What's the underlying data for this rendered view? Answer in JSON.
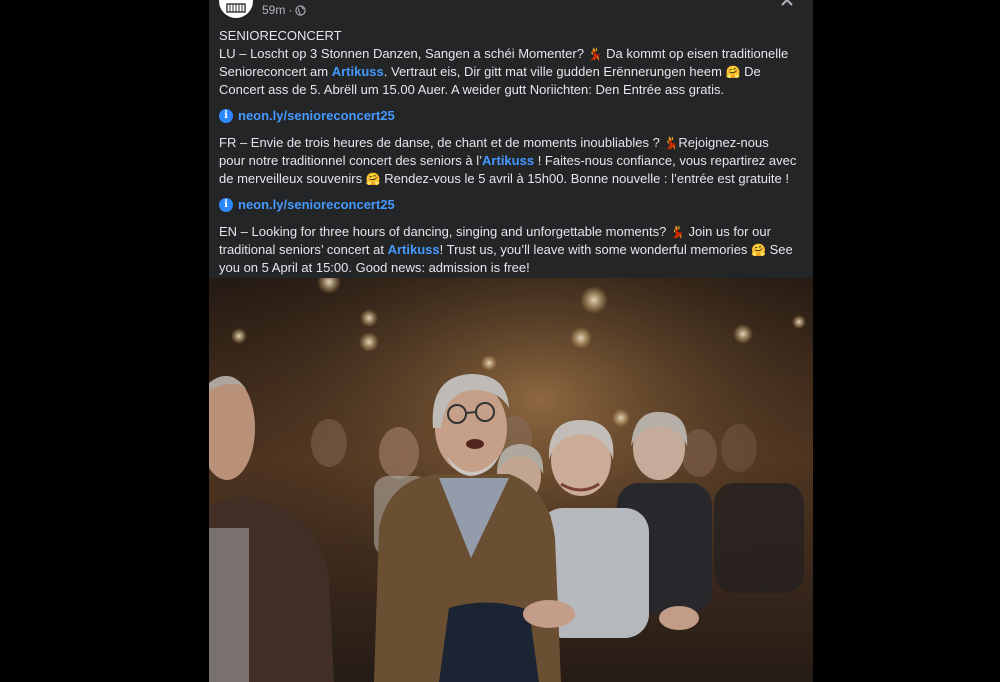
{
  "post": {
    "time": "59m",
    "separator": "·",
    "more_label": "···",
    "title": "SENIORECONCERT",
    "lu": {
      "l1a": "LU – Loscht op 3 Stonnen Danzen, Sangen a schéi Momenter? ",
      "l1b": " Da kommt op eisen traditionelle",
      "l2a": "Senioreconcert am ",
      "l2b": ". Vertraut eis, Dir gitt mat ville gudden Erënnerungen heem ",
      "l2c": " De",
      "l3": "Concert ass de 5. Abrëll um 15.00 Auer. A weider gutt Noriichten: Den Entrée ass gratis."
    },
    "fr": {
      "l1a": "FR – Envie de trois heures de danse, de chant et de moments inoubliables ? ",
      "l1b": "Rejoignez-nous",
      "l2a": "pour notre traditionnel concert des seniors à l’",
      "l2b": " ! Faites-nous confiance, vous repartirez avec",
      "l3a": "de merveilleux souvenirs ",
      "l3b": " Rendez-vous le 5 avril à 15h00.  Bonne nouvelle : l’entrée est gratuite !"
    },
    "en": {
      "l1a": "EN – Looking for three hours of dancing, singing and unforgettable moments? ",
      "l1b": " Join us for our",
      "l2a": "traditional seniors’ concert at ",
      "l2b": "! Trust us, you’ll leave with some wonderful memories ",
      "l2c": " See",
      "l3": "you on 5 April at 15:00. Good news: admission is free!"
    },
    "tag": "Artikuss",
    "link1": "neon.ly/senioreconcert25",
    "link2": "neon.ly/senioreconcert25",
    "emoji_dancer": "💃",
    "emoji_smile": "🤗",
    "info_glyph": "i"
  },
  "icons": {
    "avatar": "venue-logo-icon",
    "globe": "globe-icon",
    "info": "info-icon",
    "close": "close-icon"
  },
  "colors": {
    "background": "#000000",
    "card": "#242526",
    "text": "#e4e6eb",
    "secondary": "#b0b3b8",
    "link": "#4599ff",
    "info": "#2d88ff"
  }
}
